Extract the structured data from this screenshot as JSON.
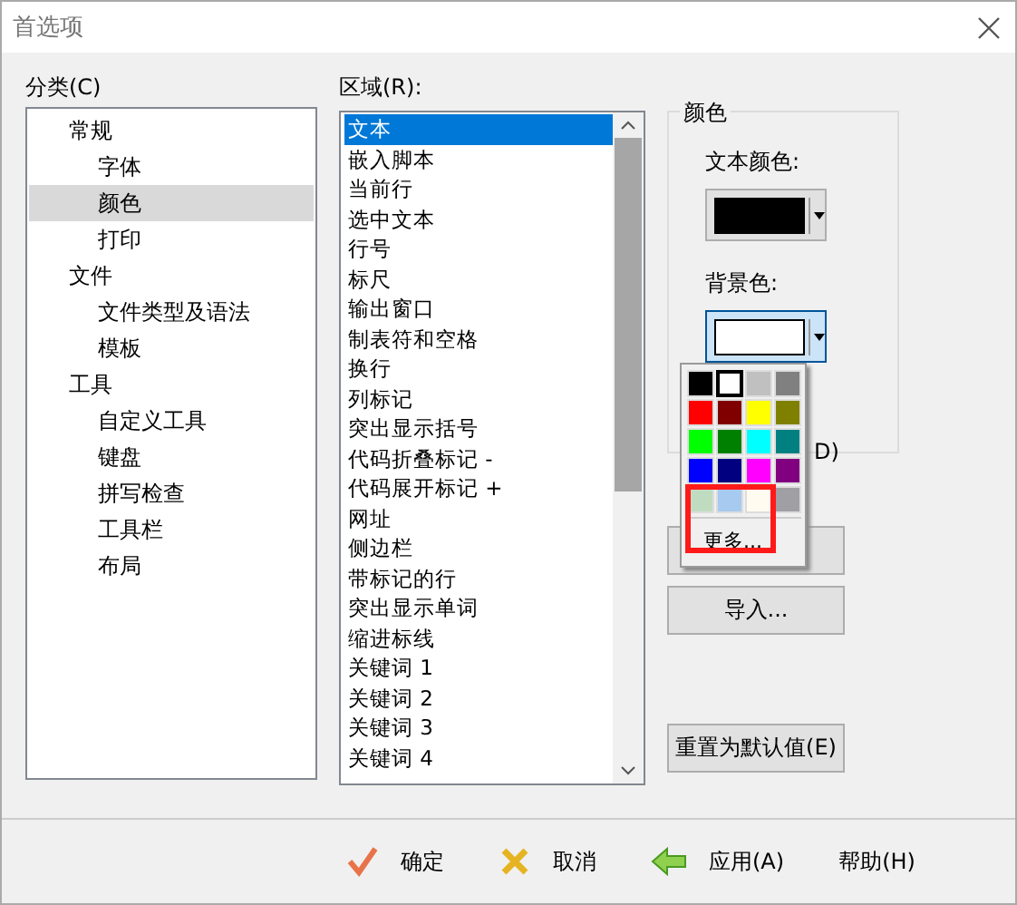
{
  "window": {
    "title": "首选项"
  },
  "category": {
    "label": "分类(C)",
    "items": [
      {
        "label": "常规",
        "selected": false,
        "children": [
          {
            "label": "字体",
            "selected": false
          },
          {
            "label": "颜色",
            "selected": true
          },
          {
            "label": "打印",
            "selected": false
          }
        ]
      },
      {
        "label": "文件",
        "selected": false,
        "children": [
          {
            "label": "文件类型及语法",
            "selected": false
          },
          {
            "label": "模板",
            "selected": false
          }
        ]
      },
      {
        "label": "工具",
        "selected": false,
        "children": [
          {
            "label": "自定义工具",
            "selected": false
          },
          {
            "label": "键盘",
            "selected": false
          },
          {
            "label": "拼写检查",
            "selected": false
          },
          {
            "label": "工具栏",
            "selected": false
          },
          {
            "label": "布局",
            "selected": false
          }
        ]
      }
    ]
  },
  "area": {
    "label": "区域(R):",
    "items": [
      {
        "label": "文本",
        "selected": true
      },
      {
        "label": "嵌入脚本",
        "selected": false
      },
      {
        "label": "当前行",
        "selected": false
      },
      {
        "label": "选中文本",
        "selected": false
      },
      {
        "label": "行号",
        "selected": false
      },
      {
        "label": "标尺",
        "selected": false
      },
      {
        "label": "输出窗口",
        "selected": false
      },
      {
        "label": "制表符和空格",
        "selected": false
      },
      {
        "label": "换行",
        "selected": false
      },
      {
        "label": "列标记",
        "selected": false
      },
      {
        "label": "突出显示括号",
        "selected": false
      },
      {
        "label": "代码折叠标记 -",
        "selected": false
      },
      {
        "label": "代码展开标记 +",
        "selected": false
      },
      {
        "label": "网址",
        "selected": false
      },
      {
        "label": "侧边栏",
        "selected": false
      },
      {
        "label": "带标记的行",
        "selected": false
      },
      {
        "label": "突出显示单词",
        "selected": false
      },
      {
        "label": "缩进标线",
        "selected": false
      },
      {
        "label": "关键词 1",
        "selected": false
      },
      {
        "label": "关键词 2",
        "selected": false
      },
      {
        "label": "关键词 3",
        "selected": false
      },
      {
        "label": "关键词 4",
        "selected": false
      }
    ]
  },
  "color_group": {
    "title": "颜色",
    "text_color": {
      "label": "文本颜色:",
      "color": "#000000"
    },
    "background_color": {
      "label": "背景色:",
      "color": "#ffffff"
    },
    "checkbox_tail": "D)",
    "palette": {
      "swatches": [
        {
          "color": "#000000",
          "selected": false
        },
        {
          "color": "#ffffff",
          "selected": true
        },
        {
          "color": "#c0c0c0",
          "selected": false
        },
        {
          "color": "#808080",
          "selected": false
        },
        {
          "color": "#ff0000",
          "selected": false
        },
        {
          "color": "#800000",
          "selected": false
        },
        {
          "color": "#ffff00",
          "selected": false
        },
        {
          "color": "#808000",
          "selected": false
        },
        {
          "color": "#00ff00",
          "selected": false
        },
        {
          "color": "#008000",
          "selected": false
        },
        {
          "color": "#00ffff",
          "selected": false
        },
        {
          "color": "#008080",
          "selected": false
        },
        {
          "color": "#0000ff",
          "selected": false
        },
        {
          "color": "#000080",
          "selected": false
        },
        {
          "color": "#ff00ff",
          "selected": false
        },
        {
          "color": "#800080",
          "selected": false
        },
        {
          "color": "#c0dcc0",
          "selected": false
        },
        {
          "color": "#a6caf0",
          "selected": false
        },
        {
          "color": "#fffbf0",
          "selected": false
        },
        {
          "color": "#a0a0a4",
          "selected": false
        }
      ],
      "more_label": "更多..."
    }
  },
  "import_button": "导入...",
  "reset_button": "重置为默认值(E)",
  "footer_buttons": [
    {
      "label": "确定",
      "kind": "ok"
    },
    {
      "label": "取消",
      "kind": "cancel"
    },
    {
      "label": "应用(A)",
      "kind": "apply"
    },
    {
      "label": "帮助(H)",
      "kind": "help"
    }
  ]
}
